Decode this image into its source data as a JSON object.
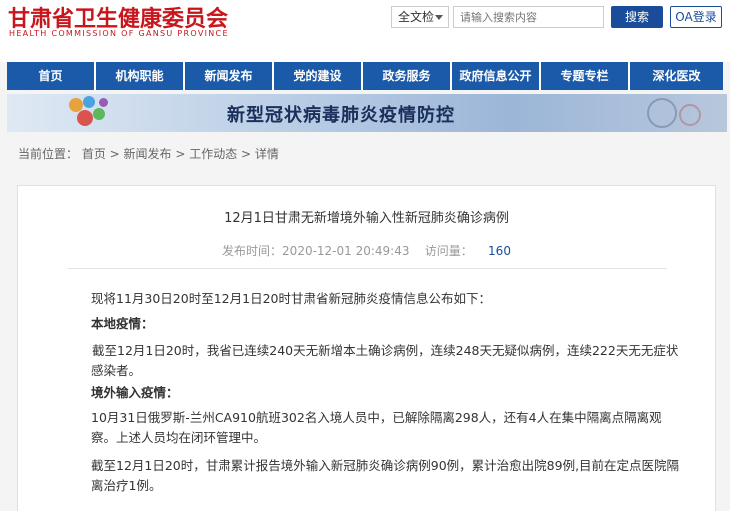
{
  "header": {
    "logo_cn": "甘肃省卫生健康委员会",
    "logo_en": "HEALTH COMMISSION OF GANSU PROVINCE"
  },
  "search": {
    "scope": "全文检",
    "placeholder": "请输入搜索内容",
    "button": "搜索",
    "oa_button": "OA登录"
  },
  "nav": {
    "items": [
      "首页",
      "机构职能",
      "新闻发布",
      "党的建设",
      "政务服务",
      "政府信息公开",
      "专题专栏",
      "深化医改"
    ]
  },
  "banner": {
    "title": "新型冠状病毒肺炎疫情防控"
  },
  "breadcrumb": {
    "label": "当前位置：",
    "path": "首页 > 新闻发布 > 工作动态 > 详情"
  },
  "article": {
    "title": "12月1日甘肃无新增境外输入性新冠肺炎确诊病例",
    "publish_label": "发布时间：",
    "publish_time": "2020-12-01 20:49:43",
    "views_label": "访问量：",
    "views": "160",
    "paragraphs": {
      "intro": "现将11月30日20时至12月1日20时甘肃省新冠肺炎疫情信息公布如下：",
      "local_heading": "本地疫情：",
      "local_text": "截至12月1日20时，我省已连续240天无新增本土确诊病例，连续248天无疑似病例，连续222天无无症状感染者。",
      "imported_heading": "境外输入疫情：",
      "imported_text": "10月31日俄罗斯-兰州CA910航班302名入境人员中，已解除隔离298人，还有4人在集中隔离点隔离观察。上述人员均在闭环管理中。",
      "summary_text": "截至12月1日20时，甘肃累计报告境外输入新冠肺炎确诊病例90例，累计治愈出院89例,目前在定点医院隔离治疗1例。"
    }
  },
  "colors": {
    "brand_red": "#c8161d",
    "nav_blue": "#1b5aa8",
    "button_blue": "#1a4c9a"
  }
}
